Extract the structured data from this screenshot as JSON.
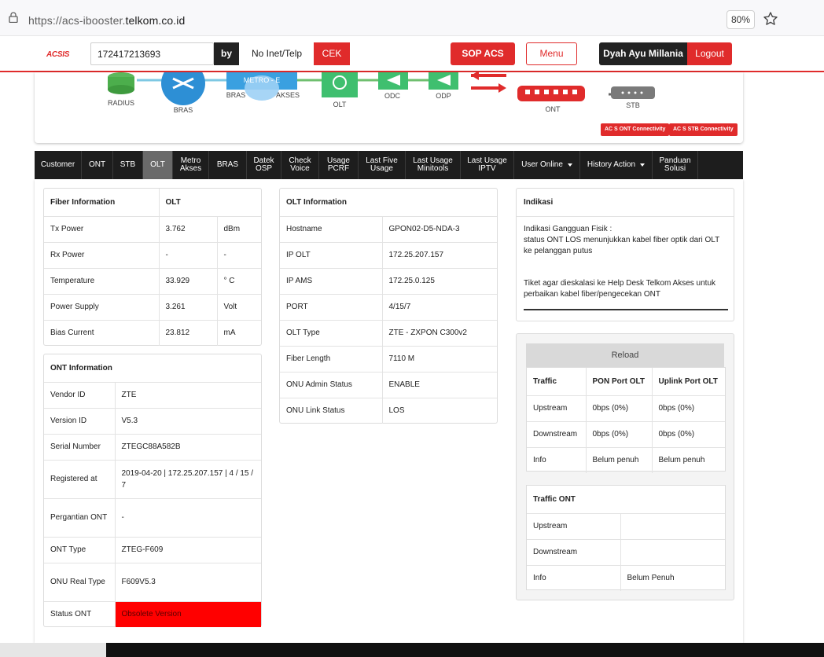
{
  "browser": {
    "url_prefix": "https://acs-ibooster.",
    "url_domain": "telkom.co.id",
    "zoom": "80%"
  },
  "appbar": {
    "logo": "ACSIS",
    "search_value": "172417213693",
    "by_label": "by",
    "select_value": "No Inet/Telp",
    "cek_label": "CEK",
    "sop_label": "SOP ACS",
    "menu_label": "Menu",
    "user_name": "Dyah Ayu Millania",
    "logout_label": "Logout"
  },
  "topology": {
    "nodes": [
      "RADIUS",
      "BRAS",
      "BRAS",
      "METRO - E",
      "AKSES",
      "OLT",
      "ODC",
      "ODP",
      "ONT",
      "STB"
    ],
    "acs_ont_btn": "AC S ONT Connectivity",
    "acs_stb_btn": "AC S STB Connectivity"
  },
  "tabs": [
    {
      "label": "Customer"
    },
    {
      "label": "ONT"
    },
    {
      "label": "STB"
    },
    {
      "label": "OLT"
    },
    {
      "label": "Metro Akses"
    },
    {
      "label": "BRAS"
    },
    {
      "label": "Datek OSP"
    },
    {
      "label": "Check Voice"
    },
    {
      "label": "Usage PCRF"
    },
    {
      "label": "Last Five Usage"
    },
    {
      "label": "Last Usage Minitools"
    },
    {
      "label": "Last Usage IPTV"
    },
    {
      "label": "User Online"
    },
    {
      "label": "History Action"
    },
    {
      "label": "Panduan Solusi"
    }
  ],
  "fiber": {
    "header": [
      "Fiber Information",
      "OLT"
    ],
    "rows": [
      [
        "Tx Power",
        "3.762",
        "dBm"
      ],
      [
        "Rx Power",
        "-",
        "-"
      ],
      [
        "Temperature",
        "33.929",
        "° C"
      ],
      [
        "Power Supply",
        "3.261",
        "Volt"
      ],
      [
        "Bias Current",
        "23.812",
        "mA"
      ]
    ]
  },
  "ont": {
    "header": "ONT Information",
    "rows": [
      [
        "Vendor ID",
        "ZTE"
      ],
      [
        "Version ID",
        "V5.3"
      ],
      [
        "Serial Number",
        "ZTEGC88A582B"
      ],
      [
        "Registered at",
        "2019-04-20 | 172.25.207.157 | 4 / 15 / 7"
      ],
      [
        "Pergantian ONT",
        "-"
      ],
      [
        "ONT Type",
        "ZTEG-F609"
      ],
      [
        "ONU Real Type",
        "F609V5.3"
      ],
      [
        "Status ONT",
        "Obsolete Version"
      ]
    ]
  },
  "olt": {
    "header": "OLT Information",
    "rows": [
      [
        "Hostname",
        "GPON02-D5-NDA-3"
      ],
      [
        "IP OLT",
        "172.25.207.157"
      ],
      [
        "IP AMS",
        "172.25.0.125"
      ],
      [
        "PORT",
        "4/15/7"
      ],
      [
        "OLT Type",
        "ZTE - ZXPON C300v2"
      ],
      [
        "Fiber Length",
        "7110 M"
      ],
      [
        "ONU Admin Status",
        "ENABLE"
      ],
      [
        "ONU Link Status",
        "LOS"
      ]
    ]
  },
  "indikasi": {
    "header": "Indikasi",
    "line1": "Indikasi Gangguan Fisik :",
    "line2": "status ONT LOS menunjukkan kabel fiber optik dari OLT ke pelanggan putus",
    "line3": "Tiket agar dieskalasi ke Help Desk Telkom Akses untuk perbaikan kabel fiber/pengecekan ONT"
  },
  "traffic": {
    "reload_label": "Reload",
    "header": [
      "Traffic",
      "PON Port OLT",
      "Uplink Port OLT"
    ],
    "rows": [
      [
        "Upstream",
        "0bps (0%)",
        "0bps (0%)"
      ],
      [
        "Downstream",
        "0bps (0%)",
        "0bps (0%)"
      ],
      [
        "Info",
        "Belum penuh",
        "Belum penuh"
      ]
    ]
  },
  "traffic_ont": {
    "header": "Traffic ONT",
    "rows": [
      [
        "Upstream",
        ""
      ],
      [
        "Downstream",
        ""
      ],
      [
        "Info",
        "Belum Penuh"
      ]
    ]
  }
}
